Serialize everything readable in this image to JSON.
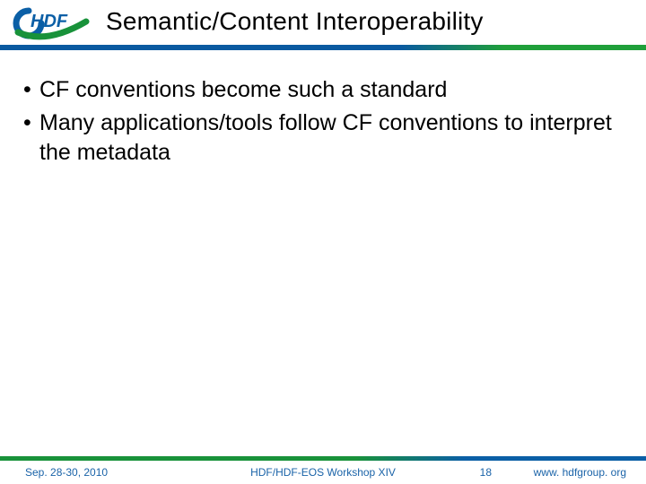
{
  "header": {
    "logo_text_top": "HDF",
    "title": "Semantic/Content Interoperability"
  },
  "body": {
    "bullets": [
      "CF conventions become such a standard",
      "Many applications/tools follow CF conventions to interpret the metadata"
    ]
  },
  "footer": {
    "date": "Sep. 28-30, 2010",
    "center": "HDF/HDF-EOS Workshop XIV",
    "page": "18",
    "url": "www. hdfgroup. org"
  },
  "colors": {
    "blue": "#0b5fa6",
    "green": "#18923a"
  }
}
